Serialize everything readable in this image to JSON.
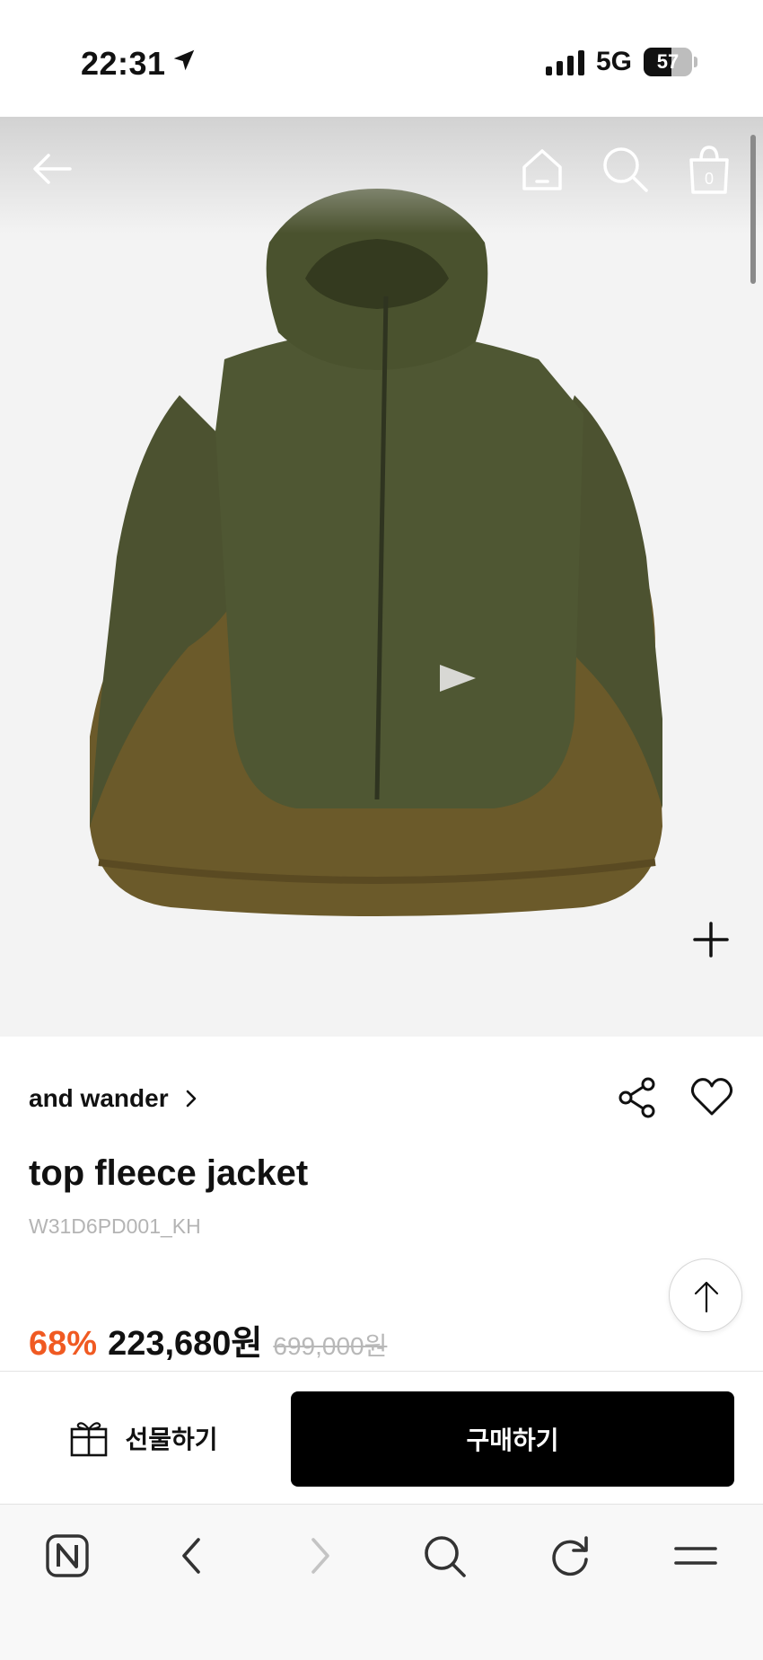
{
  "status_bar": {
    "time": "22:31",
    "network": "5G",
    "battery": "57",
    "battery_level": 0.57,
    "icons": [
      "location-arrow-icon",
      "signal-bars-icon",
      "battery-icon"
    ]
  },
  "header": {
    "icons": [
      "back-arrow-icon",
      "home-icon",
      "search-icon",
      "shopping-bag-icon"
    ],
    "cart_count": "0"
  },
  "product": {
    "image_alt": "khaki hooded fleece jacket",
    "brand": "and wander",
    "name": "top fleece jacket",
    "code": "W31D6PD001_KH",
    "discount": "68%",
    "sale_price": "223,680원",
    "original_price": "699,000원",
    "colors": {
      "discount": "#f05a22",
      "original_price": "#b8b8b8",
      "buy_button": "#000000"
    }
  },
  "actions": {
    "gift_label": "선물하기",
    "buy_label": "구매하기"
  },
  "browser_toolbar": {
    "icons": [
      "naver-home-icon",
      "back-chevron-icon",
      "forward-chevron-icon",
      "search-icon",
      "refresh-icon",
      "menu-icon"
    ]
  }
}
